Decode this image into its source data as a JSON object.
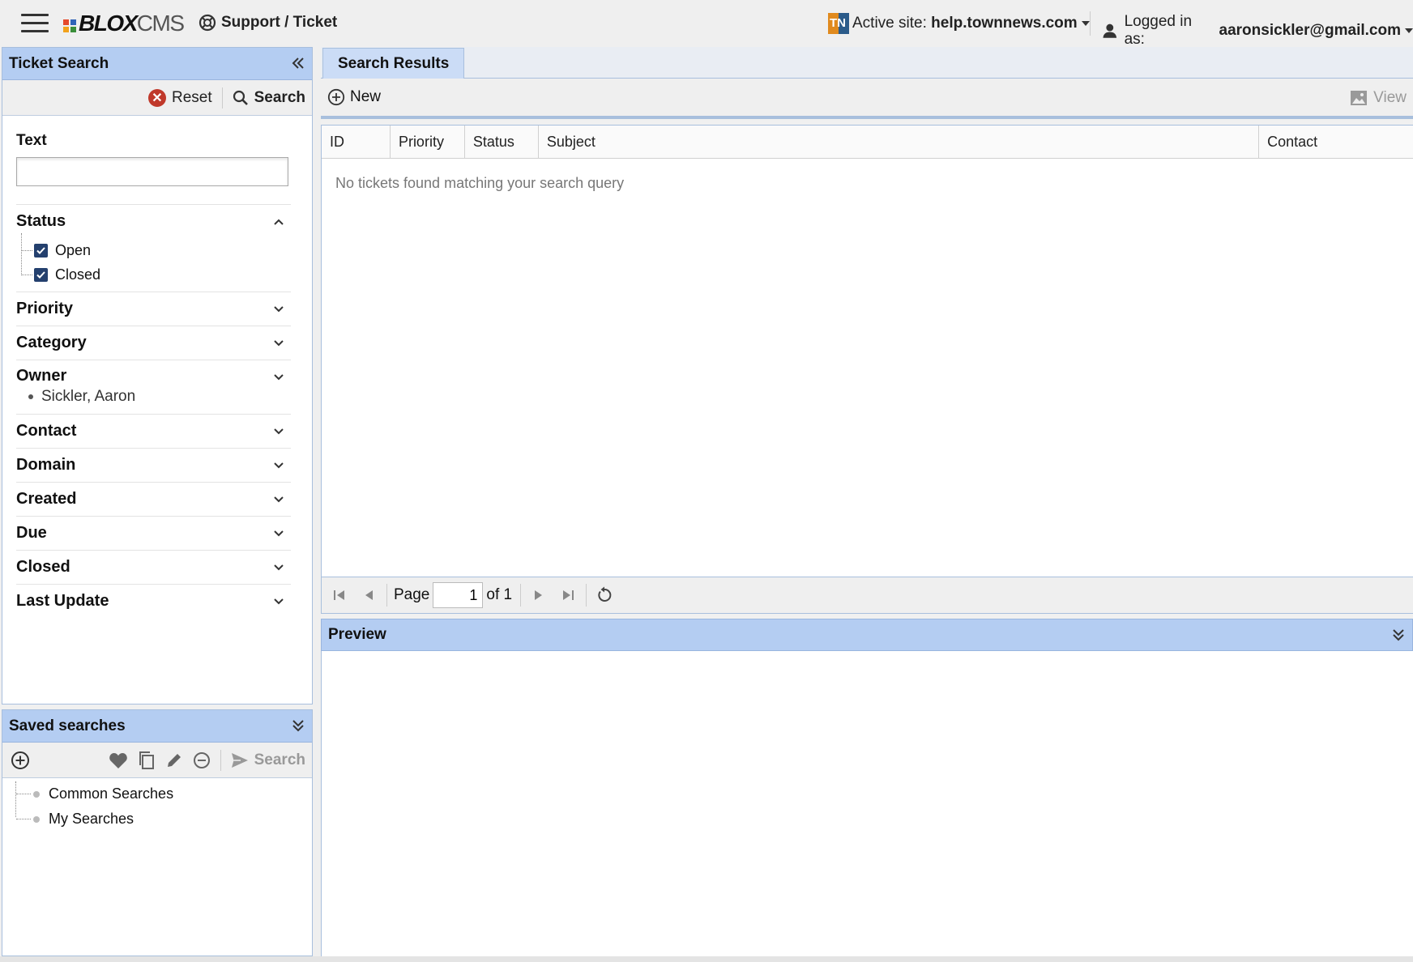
{
  "app": {
    "menu_icon": "hamburger-menu-icon",
    "logo": {
      "bold": "BLOX",
      "light": "CMS",
      "colors": [
        "#e5492b",
        "#2f63b8",
        "#f2a21b",
        "#3a8e3a"
      ]
    },
    "breadcrumb": "Support / Ticket",
    "active_site_label": "Active site:",
    "active_site_value": "help.townnews.com",
    "logged_in_label": "Logged in as:",
    "logged_in_value": "aaronsickler@gmail.com"
  },
  "ticket_search": {
    "title": "Ticket Search",
    "reset_label": "Reset",
    "search_label": "Search",
    "text_label": "Text",
    "text_value": "",
    "text_placeholder": "",
    "status": {
      "label": "Status",
      "options": [
        {
          "label": "Open",
          "checked": true
        },
        {
          "label": "Closed",
          "checked": true
        }
      ]
    },
    "filters": {
      "priority": "Priority",
      "category": "Category",
      "owner": "Owner",
      "owner_value": "Sickler, Aaron",
      "contact": "Contact",
      "domain": "Domain",
      "created": "Created",
      "due": "Due",
      "closed": "Closed",
      "last_update": "Last Update"
    }
  },
  "saved_searches": {
    "title": "Saved searches",
    "search_label": "Search",
    "items": [
      "Common Searches",
      "My Searches"
    ]
  },
  "results": {
    "tab_label": "Search Results",
    "new_label": "New",
    "view_label": "View",
    "columns": [
      "ID",
      "Priority",
      "Status",
      "Subject",
      "Contact"
    ],
    "empty_message": "No tickets found matching your search query",
    "pager": {
      "page_label": "Page",
      "page_value": "1",
      "of_label": "of 1"
    }
  },
  "preview": {
    "title": "Preview"
  },
  "colors": {
    "panel_header": "#b4cdf2",
    "border": "#a8bfdd",
    "checkbox": "#24406e",
    "reset": "#c0392b"
  }
}
